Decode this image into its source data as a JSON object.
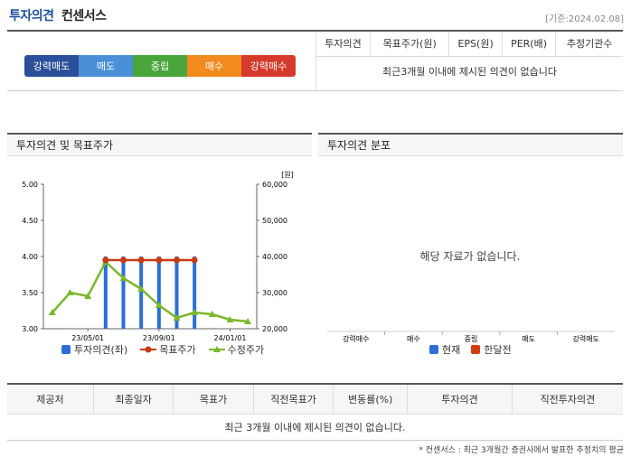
{
  "header": {
    "title_main": "투자의견",
    "title_sub": "컨센서스",
    "base_date": "[기준:2024.02.08]"
  },
  "rating_scale": [
    {
      "label": "강력매도",
      "color": "#2b4f9a"
    },
    {
      "label": "매도",
      "color": "#4a90d9"
    },
    {
      "label": "중립",
      "color": "#4aa53a"
    },
    {
      "label": "매수",
      "color": "#f28a1e"
    },
    {
      "label": "강력매수",
      "color": "#d63a2a"
    }
  ],
  "consensus_table": {
    "headers": [
      "투자의견",
      "목표주가(원)",
      "EPS(원)",
      "PER(배)",
      "추정기관수"
    ],
    "empty_message": "최근3개월 이내에 제시된 의견이 없습니다"
  },
  "left_panel": {
    "title": "투자의견 및 목표주가",
    "unit_label": "[원]",
    "legend": [
      {
        "label": "투자의견(좌)",
        "color": "#2a6fd6",
        "icon": "square"
      },
      {
        "label": "목표주가",
        "color": "#c83a12",
        "icon": "circle-line"
      },
      {
        "label": "수정주가",
        "color": "#7ab82a",
        "icon": "triangle-line"
      }
    ]
  },
  "right_panel": {
    "title": "투자의견 분포",
    "empty_message": "해당 자료가 없습니다.",
    "categories": [
      "강력매수",
      "매수",
      "중립",
      "매도",
      "강력매도"
    ],
    "legend": [
      {
        "label": "현재",
        "color": "#2a6fd6"
      },
      {
        "label": "한달전",
        "color": "#d63a12"
      }
    ]
  },
  "chart_data": [
    {
      "type": "line",
      "x_ticks": [
        "23/05/01",
        "23/09/01",
        "24/01/01"
      ],
      "y_left_ticks": [
        "5.00",
        "4.50",
        "4.00",
        "3.50",
        "3.00"
      ],
      "y_right_ticks": [
        "60,000",
        "50,000",
        "40,000",
        "30,000",
        "20,000"
      ],
      "ylim_left": [
        3.0,
        5.0
      ],
      "ylim_right": [
        20000,
        60000
      ],
      "unit": "[원]",
      "x": [
        "23/03",
        "23/04",
        "23/05",
        "23/06",
        "23/07",
        "23/08",
        "23/09",
        "23/10",
        "23/11",
        "23/12",
        "24/01",
        "24/02"
      ],
      "series": [
        {
          "name": "투자의견(좌)",
          "kind": "bar",
          "axis": "left",
          "color": "#2a6fd6",
          "points": [
            [
              3,
              4.0
            ],
            [
              4,
              4.0
            ],
            [
              5,
              4.0
            ],
            [
              6,
              4.0
            ],
            [
              7,
              4.0
            ],
            [
              8,
              4.0
            ]
          ]
        },
        {
          "name": "목표주가",
          "kind": "line",
          "axis": "right",
          "color": "#c83a12",
          "points": [
            [
              3,
              39000
            ],
            [
              4,
              39000
            ],
            [
              5,
              39000
            ],
            [
              6,
              39000
            ],
            [
              7,
              39000
            ],
            [
              8,
              39000
            ]
          ]
        },
        {
          "name": "수정주가",
          "kind": "line",
          "axis": "right",
          "color": "#7ab82a",
          "points": [
            [
              0,
              24500
            ],
            [
              1,
              30000
            ],
            [
              2,
              29000
            ],
            [
              3,
              38500
            ],
            [
              4,
              34000
            ],
            [
              5,
              31000
            ],
            [
              6,
              26500
            ],
            [
              7,
              23000
            ],
            [
              8,
              24500
            ],
            [
              9,
              24000
            ],
            [
              10,
              22500
            ],
            [
              11,
              22000
            ]
          ]
        }
      ]
    },
    {
      "type": "bar",
      "categories": [
        "강력매수",
        "매수",
        "중립",
        "매도",
        "강력매도"
      ],
      "series": [
        {
          "name": "현재",
          "values": []
        },
        {
          "name": "한달전",
          "values": []
        }
      ]
    }
  ],
  "bottom_table": {
    "headers": [
      "제공처",
      "최종일자",
      "목표가",
      "직전목표가",
      "변동률(%)",
      "투자의견",
      "직전투자의견"
    ],
    "empty_message": "최근 3개월 이내에 제시된 의견이 없습니다."
  },
  "footnote": "* 컨센서스 : 최근 3개월간 증권사에서 발표한 추정치의 평균"
}
